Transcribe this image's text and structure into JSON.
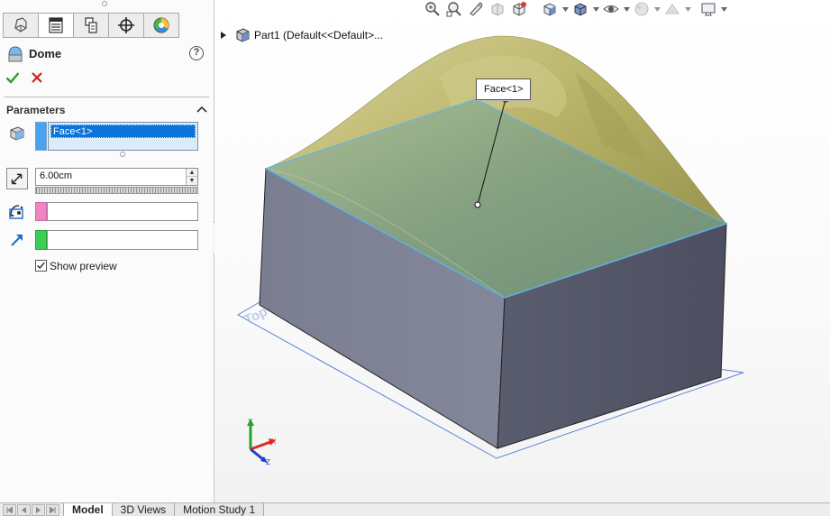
{
  "property_manager": {
    "tabs": [
      {
        "id": "featuremanager",
        "icon": "feature-tree-icon",
        "active": false
      },
      {
        "id": "propertymanager",
        "icon": "property-manager-icon",
        "active": true
      },
      {
        "id": "configurationmanager",
        "icon": "configuration-manager-icon",
        "active": false
      },
      {
        "id": "dimxpertmanager",
        "icon": "dimxpert-icon",
        "active": false
      },
      {
        "id": "displaymanager",
        "icon": "display-manager-icon",
        "active": false
      }
    ],
    "feature_icon": "dome-icon",
    "title": "Dome",
    "help_label": "?",
    "ok_icon": "check-icon",
    "cancel_icon": "x-icon",
    "group": {
      "title": "Parameters",
      "faces": {
        "icon": "face-selection-icon",
        "color": "#4aa3f0",
        "items": [
          "Face<1>"
        ]
      },
      "distance": {
        "icon": "distance-icon",
        "value": "6.00cm"
      },
      "constraint_point": {
        "icon": "constraint-point-icon",
        "color": "#ef86c2",
        "value": ""
      },
      "direction": {
        "icon": "direction-arrow-icon",
        "color": "#3ccf58",
        "value": ""
      },
      "show_preview": {
        "label": "Show preview",
        "checked": true
      }
    }
  },
  "viewport": {
    "tree_flyout": {
      "part_icon": "part-icon",
      "label": "Part1  (Default<<Default>..."
    },
    "callout": "Face<1>",
    "plane_label": "Top Plane",
    "heads_up_toolbar": [
      "zoom-to-fit-icon",
      "zoom-to-area-icon",
      "previous-view-icon",
      "section-view-icon",
      "dynamic-annotation-icon",
      "view-orientation-icon",
      "display-style-icon",
      "hide-show-items-icon",
      "edit-appearance-icon",
      "apply-scene-icon",
      "view-settings-icon"
    ],
    "colors": {
      "face_selected": "#7fa07f",
      "side_left": "#7c7f92",
      "side_right": "#575a6b",
      "dome": "#c9c57e",
      "edge_highlight": "#5fb4ea",
      "plane": "#5b82d6"
    }
  },
  "bottom_tabs": [
    {
      "label": "Model",
      "active": true
    },
    {
      "label": "3D Views",
      "active": false
    },
    {
      "label": "Motion Study 1",
      "active": false
    }
  ]
}
